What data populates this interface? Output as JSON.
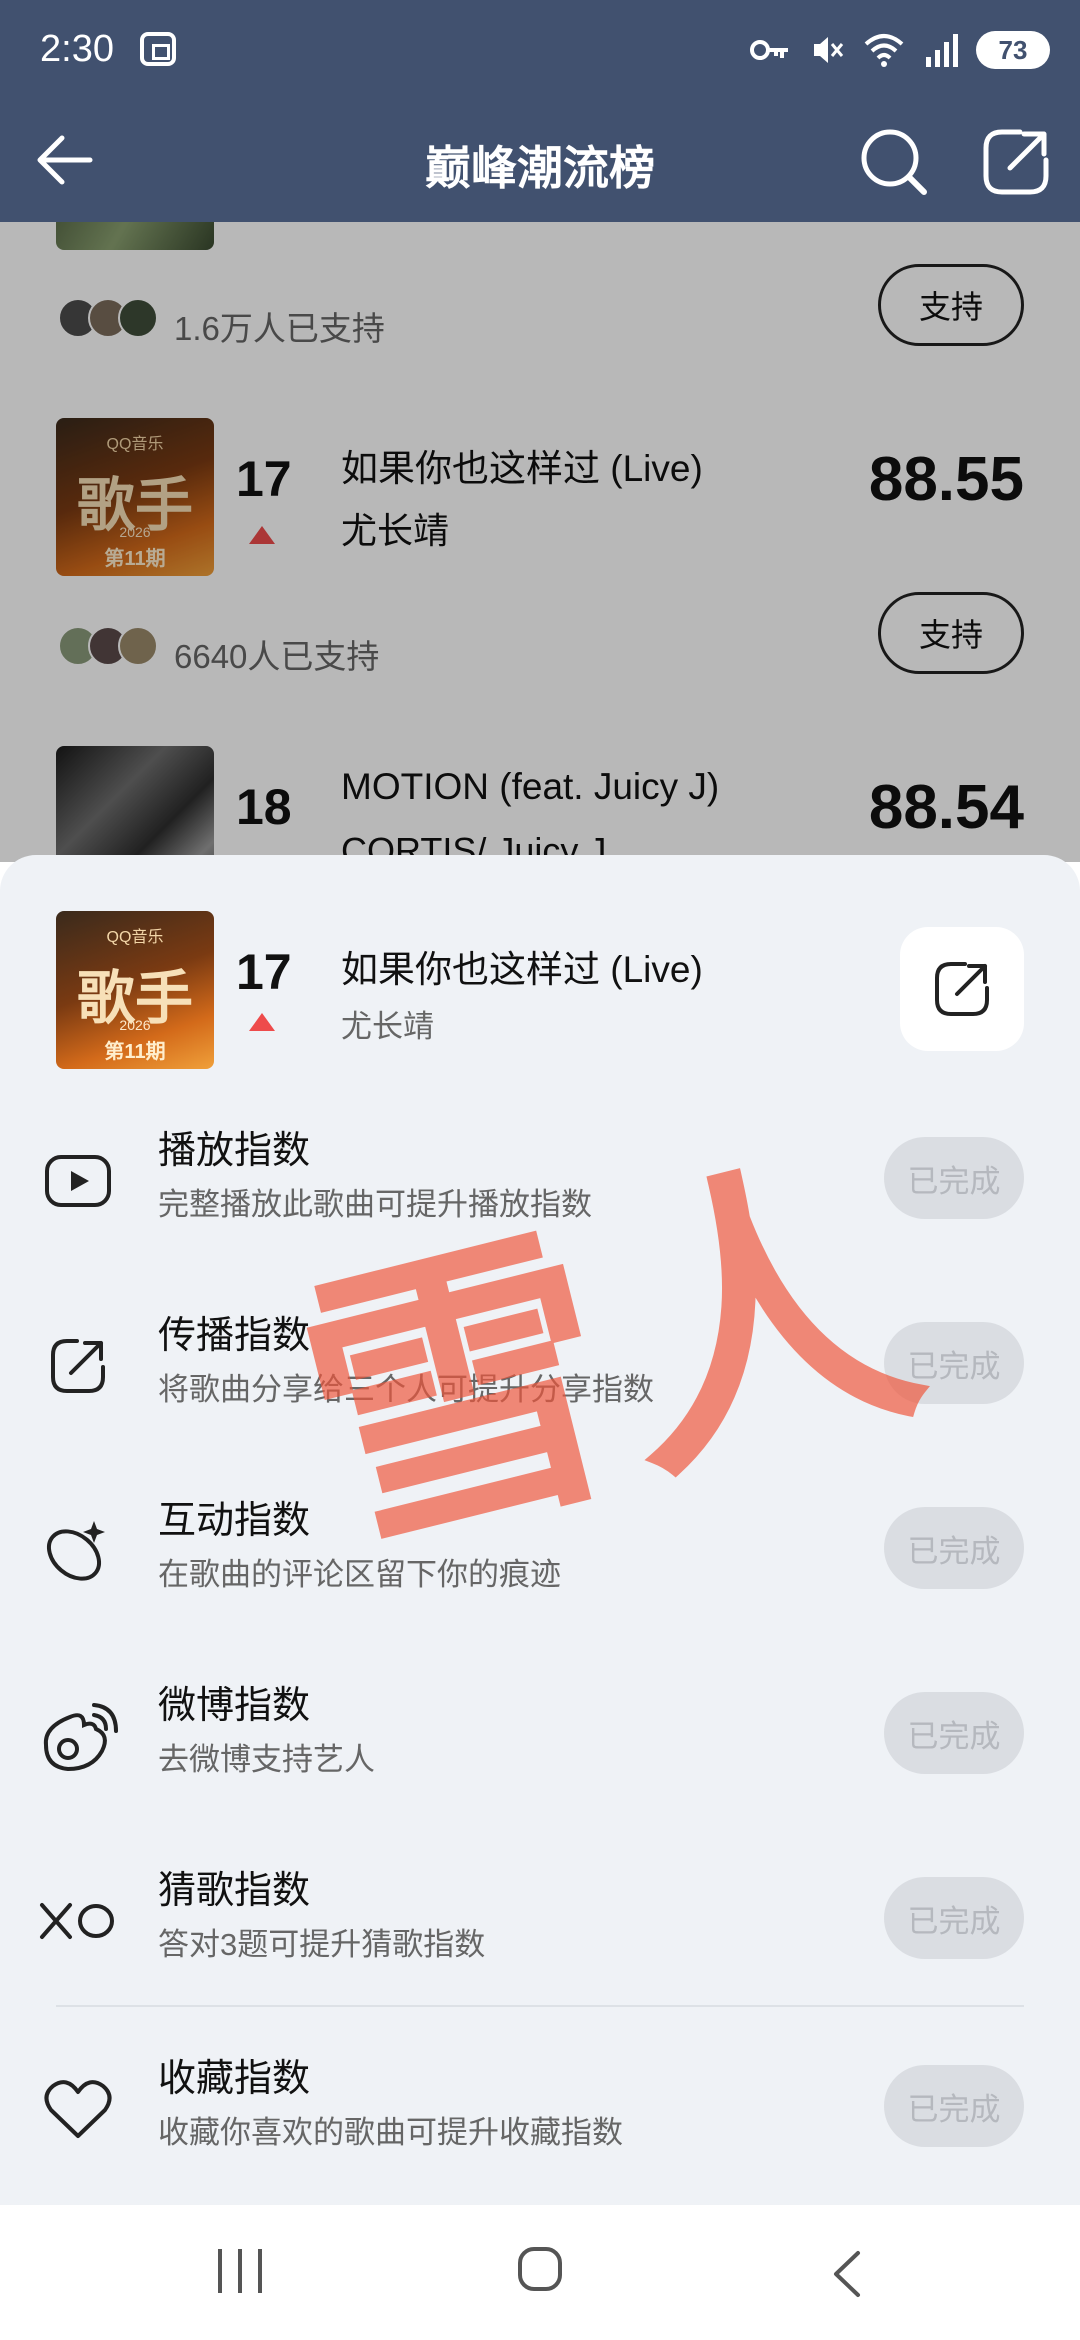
{
  "status_bar": {
    "time": "2:30",
    "battery": "73"
  },
  "header": {
    "title": "巅峰潮流榜"
  },
  "list": {
    "top_item": {
      "supporters": "1.6万人已支持",
      "support_label": "支持"
    },
    "items": [
      {
        "rank": "17",
        "title": "如果你也这样过 (Live)",
        "artist": "尤长靖",
        "score": "88.55",
        "supporters": "6640人已支持",
        "support_label": "支持",
        "trend": "up"
      },
      {
        "rank": "18",
        "title": "MOTION (feat. Juicy J)",
        "artist": "CORTIS/ Juicy J",
        "score": "88.54"
      }
    ]
  },
  "cover_art": {
    "brand": "QQ音乐",
    "big": "歌手",
    "year": "2026",
    "episode": "第11期"
  },
  "sheet": {
    "song": {
      "rank": "17",
      "title": "如果你也这样过 (Live)",
      "artist": "尤长靖",
      "trend": "up"
    },
    "tasks": [
      {
        "icon": "play-icon",
        "title": "播放指数",
        "desc": "完整播放此歌曲可提升播放指数",
        "status": "已完成"
      },
      {
        "icon": "share-icon",
        "title": "传播指数",
        "desc": "将歌曲分享给三个人可提升分享指数",
        "status": "已完成"
      },
      {
        "icon": "comment-sparkle-icon",
        "title": "互动指数",
        "desc": "在歌曲的评论区留下你的痕迹",
        "status": "已完成"
      },
      {
        "icon": "weibo-icon",
        "title": "微博指数",
        "desc": "去微博支持艺人",
        "status": "已完成"
      },
      {
        "icon": "xo-icon",
        "title": "猜歌指数",
        "desc": "答对3题可提升猜歌指数",
        "status": "已完成"
      },
      {
        "icon": "heart-icon",
        "title": "收藏指数",
        "desc": "收藏你喜欢的歌曲可提升收藏指数",
        "status": "已完成"
      }
    ]
  },
  "watermark": "雪人",
  "colors": {
    "header_bg": "#41516f",
    "trend_up": "#ee4b4b",
    "sheet_bg": "#eff2f6",
    "watermark": "#f0553a"
  }
}
